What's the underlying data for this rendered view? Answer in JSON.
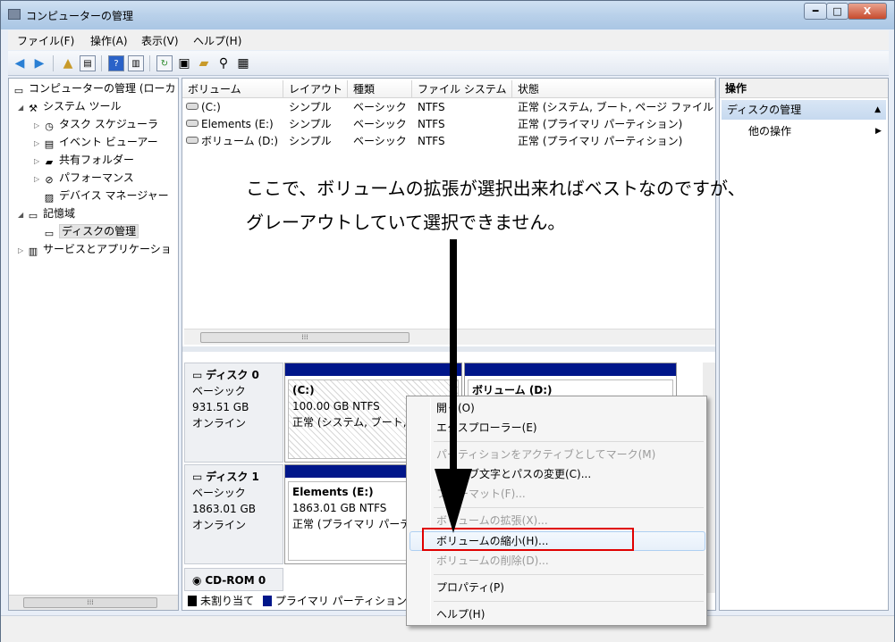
{
  "window": {
    "title": "コンピューターの管理",
    "min": "━",
    "max": "□",
    "close": "X"
  },
  "menu": [
    "ファイル(F)",
    "操作(A)",
    "表示(V)",
    "ヘルプ(H)"
  ],
  "tree": {
    "root": "コンピューターの管理 (ローカ",
    "system_tools": "システム ツール",
    "task_scheduler": "タスク スケジューラ",
    "event_viewer": "イベント ビューアー",
    "shared_folders": "共有フォルダー",
    "performance": "パフォーマンス",
    "device_manager": "デバイス マネージャー",
    "storage": "記憶域",
    "disk_management": "ディスクの管理",
    "services_apps": "サービスとアプリケーショ"
  },
  "volume_table": {
    "headers": [
      "ボリューム",
      "レイアウト",
      "種類",
      "ファイル システム",
      "状態"
    ],
    "rows": [
      {
        "volume": "(C:)",
        "layout": "シンプル",
        "type": "ベーシック",
        "fs": "NTFS",
        "status": "正常 (システム, ブート, ページ ファイル"
      },
      {
        "volume": "Elements (E:)",
        "layout": "シンプル",
        "type": "ベーシック",
        "fs": "NTFS",
        "status": "正常 (プライマリ パーティション)"
      },
      {
        "volume": "ボリューム (D:)",
        "layout": "シンプル",
        "type": "ベーシック",
        "fs": "NTFS",
        "status": "正常 (プライマリ パーティション)"
      }
    ]
  },
  "annotation": {
    "line1": "ここで、ボリュームの拡張が選択出来ればベストなのですが、",
    "line2": "グレーアウトしていて選択できません。"
  },
  "disks": {
    "disk0": {
      "name": "ディスク 0",
      "type": "ベーシック",
      "size": "931.51 GB",
      "state": "オンライン"
    },
    "disk1": {
      "name": "ディスク 1",
      "type": "ベーシック",
      "size": "1863.01 GB",
      "state": "オンライン"
    },
    "cdrom": {
      "name": "CD-ROM 0"
    }
  },
  "partitions": {
    "c": {
      "name": "(C:)",
      "size": "100.00 GB NTFS",
      "status": "正常 (システム, ブート,"
    },
    "d": {
      "name": "ボリューム (D:)"
    },
    "e": {
      "name": "Elements (E:)",
      "size": "1863.01 GB NTFS",
      "status": "正常 (プライマリ パーテ"
    }
  },
  "legend": {
    "unallocated": "未割り当て",
    "primary": "プライマリ パーティション"
  },
  "actions": {
    "header": "操作",
    "selected": "ディスクの管理",
    "other": "他の操作"
  },
  "context_menu": {
    "open": "開く(O)",
    "explore": "エクスプローラー(E)",
    "mark_active": "パーティションをアクティブとしてマーク(M)",
    "change_letter": "ドライブ文字とパスの変更(C)...",
    "format": "フォーマット(F)...",
    "extend": "ボリュームの拡張(X)...",
    "shrink": "ボリュームの縮小(H)...",
    "delete": "ボリュームの削除(D)...",
    "properties": "プロパティ(P)",
    "help": "ヘルプ(H)"
  },
  "colors": {
    "primary_partition": "#00168a",
    "unallocated": "#000000",
    "highlight": "#e00000"
  }
}
